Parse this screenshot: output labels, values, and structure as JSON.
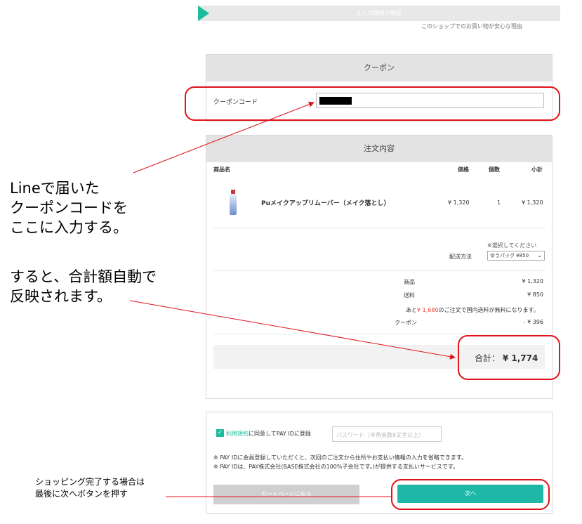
{
  "step": {
    "label": "2.入力情報の確認",
    "reason_link": "このショップでのお買い物が安心な理由"
  },
  "coupon": {
    "title": "クーポン",
    "label": "クーポンコード"
  },
  "order": {
    "title": "注文内容",
    "columns": {
      "product": "商品名",
      "price": "価格",
      "qty": "個数",
      "subtotal": "小計"
    },
    "item": {
      "name": "Puメイクアップリムーバー（メイク落とし）",
      "price": "¥ 1,320",
      "qty": "1",
      "subtotal": "¥ 1,320"
    },
    "shipping": {
      "note": "※選択してください",
      "label": "配送方法",
      "selected": "ゆうパック ¥850"
    },
    "summary": {
      "goods_label": "商品",
      "goods_value": "¥ 1,320",
      "shipping_label": "送料",
      "shipping_value": "¥ 850",
      "free_prefix": "あと",
      "free_amount": "¥ 1,680",
      "free_suffix": "のご注文で国内送料が無料になります。",
      "coupon_label": "クーポン",
      "coupon_value": "- ¥ 396"
    },
    "total": {
      "label": "合計：",
      "value": "¥ 1,774"
    }
  },
  "pay": {
    "check_mark": "✓",
    "terms_link": "利用規約",
    "terms_rest": "に同意してPAY IDに登録",
    "password_placeholder": "パスワード（半角英数8文字以上）",
    "note1": "※ PAY IDに会員登録していただくと、次回のご注文から住所やお支払い情報の入力を省略できます。",
    "note2": "※ PAY IDは、PAY株式会社(BASE株式会社の100%子会社です。)が提供する支払いサービスです。"
  },
  "buttons": {
    "back": "カートページに戻る",
    "next": "次へ"
  },
  "annotations": {
    "line1": "Lineで届いた",
    "line2": "クーポンコードを",
    "line3": "ここに入力する。",
    "line4": "すると、合計額自動で",
    "line5": "反映されます。",
    "small1": "ショッピング完了する場合は",
    "small2": "最後に次へボタンを押す"
  },
  "colors": {
    "accent": "#1abc9c",
    "highlight": "#e0121b"
  }
}
